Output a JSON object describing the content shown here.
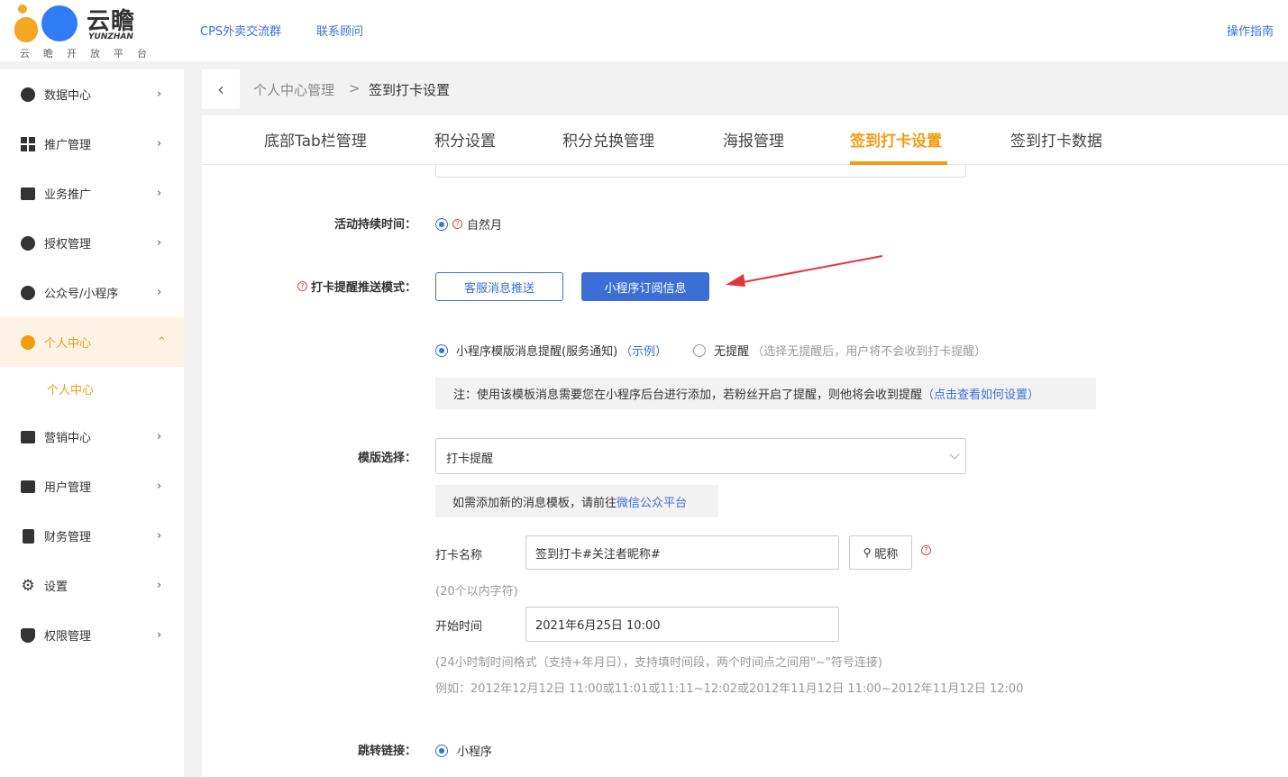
{
  "header": {
    "brand": "云瞻",
    "brand_en": "YUNZHAN",
    "brand_sub": "云瞻开放平台",
    "links": [
      "CPS外卖交流群",
      "联系顾问"
    ],
    "guide": "操作指南"
  },
  "sidebar": {
    "items": [
      {
        "label": "数据中心",
        "icon": "data-center-icon"
      },
      {
        "label": "推广管理",
        "icon": "promotion-grid-icon"
      },
      {
        "label": "业务推广",
        "icon": "megaphone-icon"
      },
      {
        "label": "授权管理",
        "icon": "user-key-icon"
      },
      {
        "label": "公众号/小程序",
        "icon": "wechat-icon"
      },
      {
        "label": "个人中心",
        "icon": "person-icon"
      },
      {
        "label": "营销中心",
        "icon": "gift-icon"
      },
      {
        "label": "用户管理",
        "icon": "user-card-icon"
      },
      {
        "label": "财务管理",
        "icon": "finance-icon"
      },
      {
        "label": "设置",
        "icon": "gear-icon"
      },
      {
        "label": "权限管理",
        "icon": "shield-icon"
      }
    ],
    "sub_item": "个人中心",
    "active_color": "#f39c12"
  },
  "breadcrumb": {
    "parent": "个人中心管理",
    "separator": ">",
    "current": "签到打卡设置"
  },
  "tabs": [
    "底部Tab栏管理",
    "积分设置",
    "积分兑换管理",
    "海报管理",
    "签到打卡设置",
    "签到打卡数据"
  ],
  "active_tab": "签到打卡设置",
  "form": {
    "duration_label": "活动持续时间：",
    "duration_value": "自然月",
    "push_mode_label": "打卡提醒推送模式：",
    "push_btn_service": "客服消息推送",
    "push_btn_subscribe": "小程序订阅信息",
    "opt_template": "小程序模版消息提醒(服务通知)",
    "opt_template_example": "（示例）",
    "opt_none": "无提醒",
    "opt_none_hint": "（选择无提醒后，用户将不会收到打卡提醒）",
    "note_prefix": "注：使用该模板消息需要您在小程序后台进行添加，若粉丝开启了提醒，则他将会收到提醒",
    "note_link": "（点击查看如何设置）",
    "template_label": "模版选择：",
    "template_value": "打卡提醒",
    "template_note_prefix": "如需添加新的消息模板，请前往",
    "template_note_link": "微信公众平台",
    "checkin_name_label": "打卡名称",
    "checkin_name_value": "签到打卡#关注者昵称#",
    "nickname_btn": "昵称",
    "checkin_name_hint": "(20个以内字符)",
    "start_time_label": "开始时间",
    "start_time_value": "2021年6月25日 10:00",
    "time_hint_1": "(24小时制时间格式（支持+年月日），支持填时间段，两个时间点之间用\"~\"符号连接)",
    "time_hint_2": "例如：2012年12月12日 11:00或11:01或11:11~12:02或2012年11月12日 11:00~2012年11月12日 12:00",
    "jump_label": "跳转链接：",
    "jump_value": "小程序"
  },
  "colors": {
    "accent_blue": "#3b6fd6",
    "accent_orange": "#f39c12",
    "arrow_red": "#e8333a"
  }
}
